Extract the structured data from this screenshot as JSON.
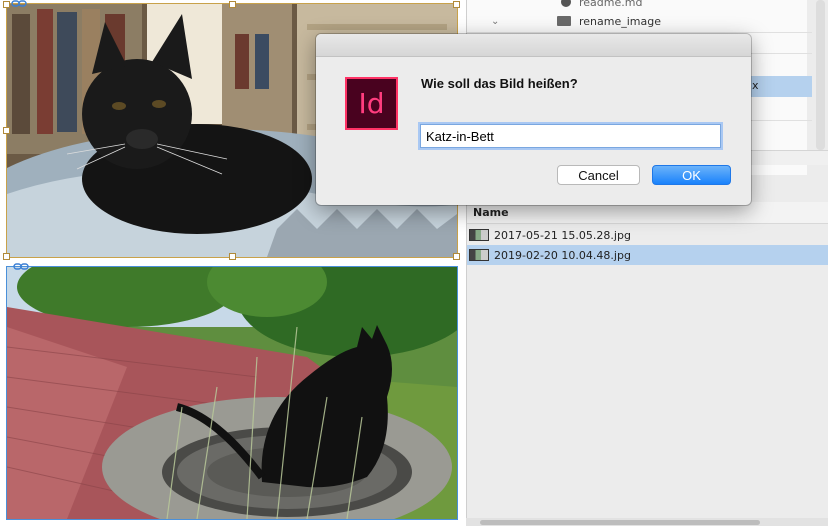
{
  "dialog": {
    "message": "Wie soll das Bild heißen?",
    "input_value": "Katz-in-Bett",
    "cancel_label": "Cancel",
    "ok_label": "OK",
    "app_icon_text": "Id",
    "app_icon_name": "indesign-app-icon"
  },
  "file_browser": {
    "tree_items": [
      {
        "label": "readme.md",
        "icon": "info-icon"
      },
      {
        "label": "rename_image",
        "icon": "folder-icon",
        "expanded": true
      }
    ],
    "partial_item_suffix": "x",
    "column_header": "Name",
    "files": [
      {
        "name": "2017-05-21 15.05.28.jpg",
        "selected": false
      },
      {
        "name": "2019-02-20 10.04.48.jpg",
        "selected": true
      }
    ]
  },
  "colors": {
    "selection": "#b5d1ee",
    "ok_button": "#1a82fb",
    "indesign_pink": "#ff3366",
    "indesign_dark": "#49021f"
  }
}
